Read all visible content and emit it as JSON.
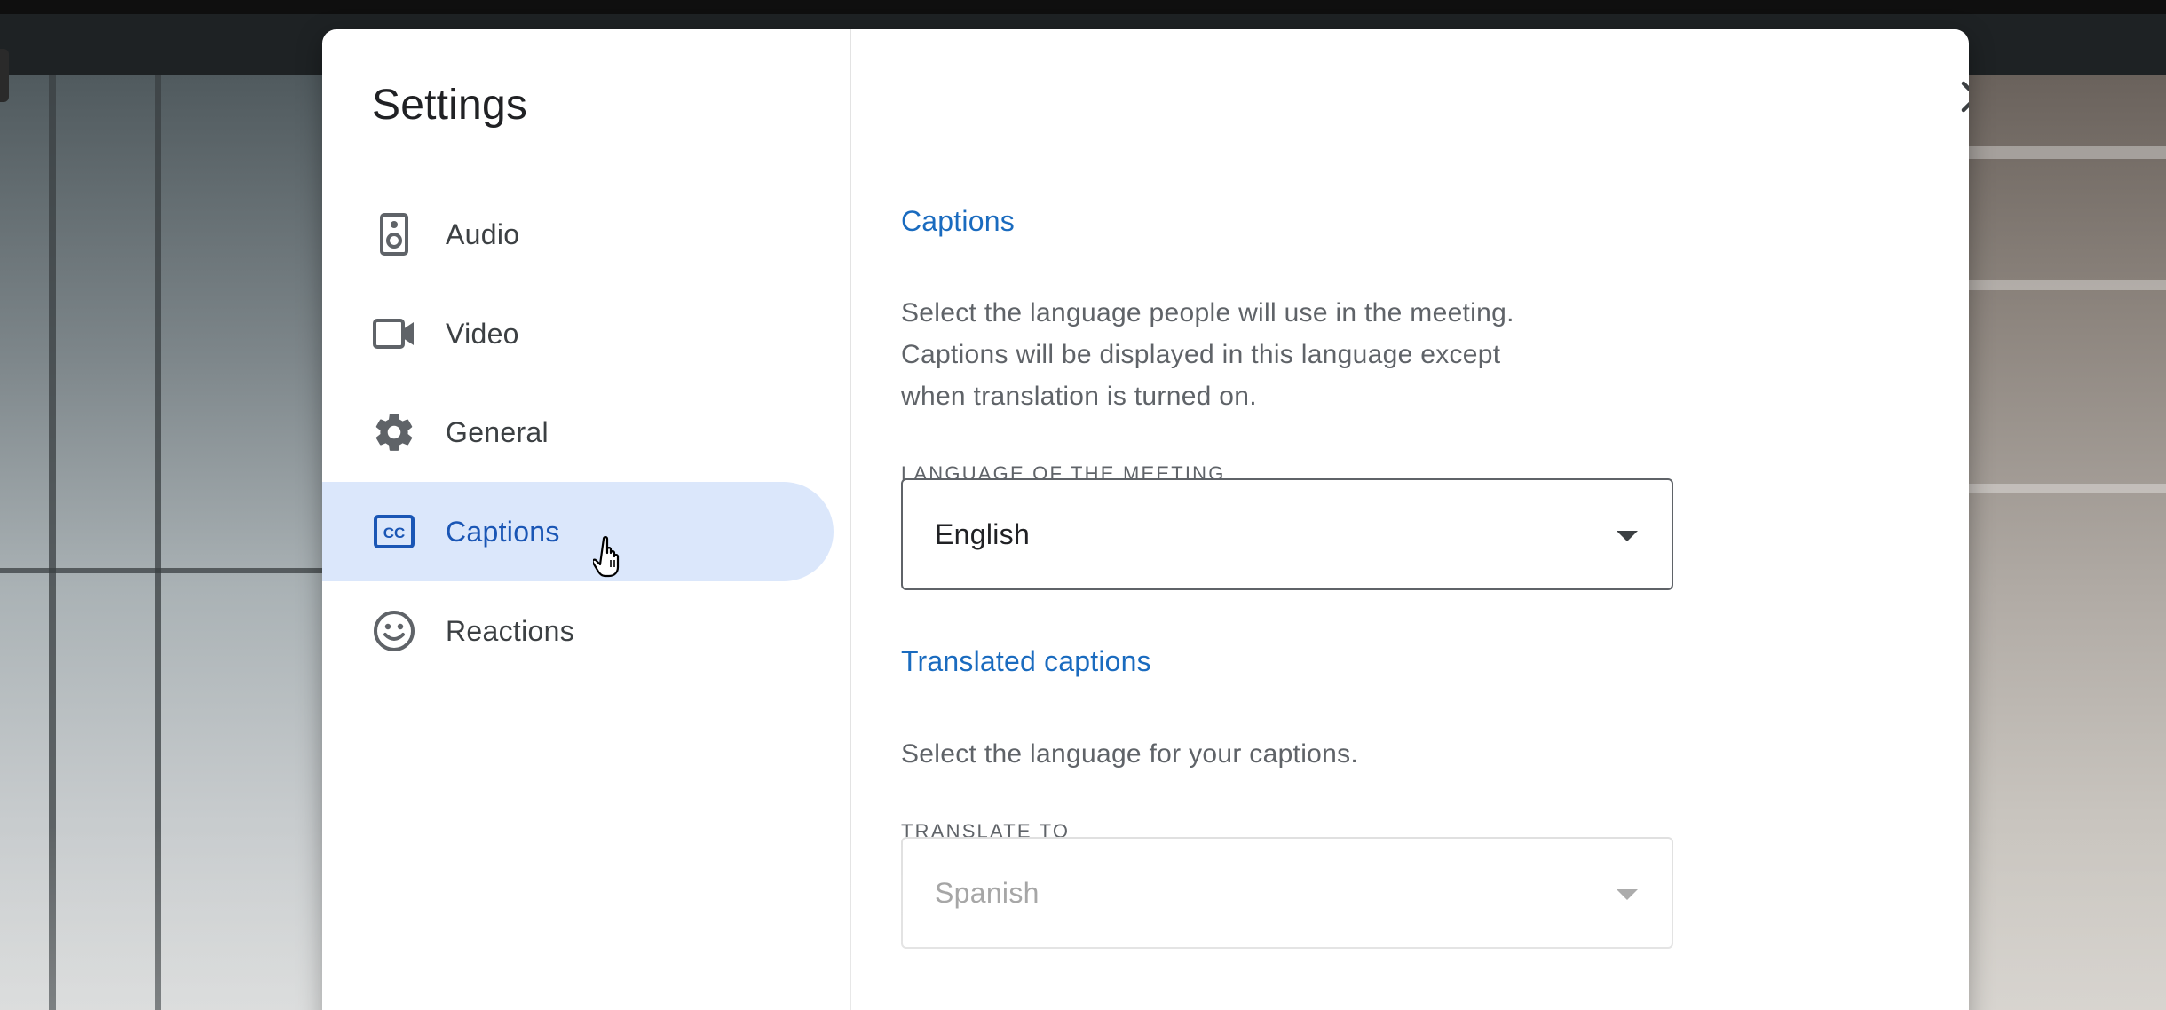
{
  "dialog": {
    "title": "Settings",
    "close_icon": "close-icon"
  },
  "sidebar": {
    "items": [
      {
        "label": "Audio",
        "icon": "speaker-icon",
        "active": false
      },
      {
        "label": "Video",
        "icon": "video-camera-icon",
        "active": false
      },
      {
        "label": "General",
        "icon": "gear-icon",
        "active": false
      },
      {
        "label": "Captions",
        "icon": "closed-captions-icon",
        "active": true
      },
      {
        "label": "Reactions",
        "icon": "smiley-icon",
        "active": false
      }
    ]
  },
  "captions": {
    "title": "Captions",
    "description": "Select the language people will use in the meeting. Captions will be displayed in this language except when translation is turned on.",
    "enabled": false,
    "language_label": "LANGUAGE OF THE MEETING",
    "language_value": "English"
  },
  "translated": {
    "title": "Translated captions",
    "description": "Select the language for your captions.",
    "enabled": false,
    "translate_label": "TRANSLATE TO",
    "translate_value": "Spanish"
  },
  "colors": {
    "accent": "#1a6bbf",
    "active_bg": "#dbe7fb",
    "active_text": "#1a56b5"
  }
}
